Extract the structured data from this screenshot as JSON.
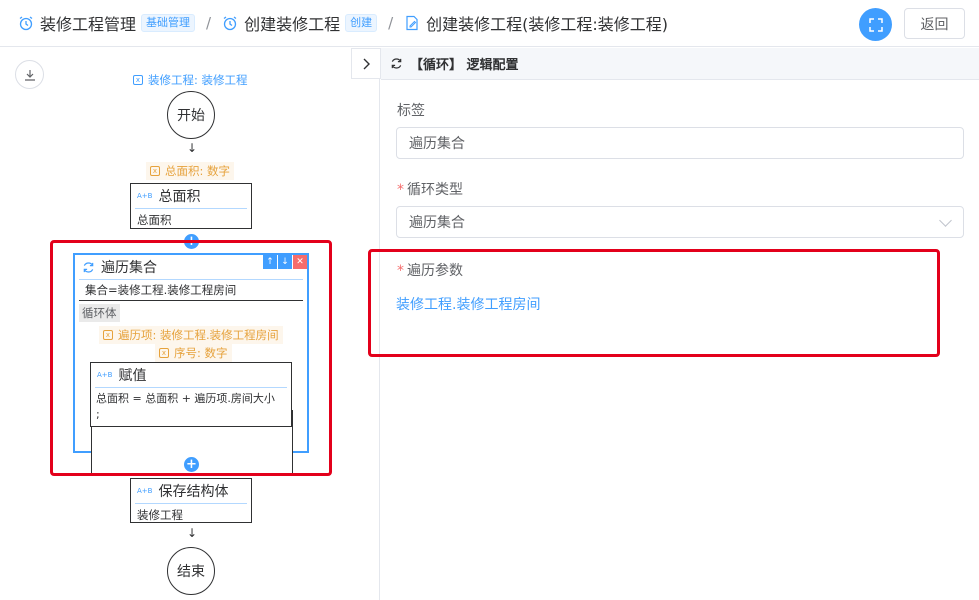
{
  "breadcrumb": [
    {
      "label": "装修工程管理",
      "tag": "基础管理",
      "icon": "alarm-clock-icon"
    },
    {
      "label": "创建装修工程",
      "tag": "创建",
      "icon": "alarm-clock-icon"
    },
    {
      "label": "创建装修工程(装修工程:装修工程)",
      "tag": "",
      "icon": "document-edit-icon"
    }
  ],
  "header": {
    "back_label": "返回"
  },
  "canvas": {
    "input_param": "装修工程: 装修工程",
    "start_label": "开始",
    "end_label": "结束",
    "area_param": "总面积: 数字",
    "node_area": {
      "badge": "A+B",
      "title": "总面积",
      "body": "总面积"
    },
    "loop": {
      "title": "遍历集合",
      "collection": "集合=装修工程.装修工程房间",
      "body_label": "循环体",
      "item_param": "遍历项: 装修工程.装修工程房间",
      "index_param": "序号: 数字"
    },
    "node_assign": {
      "badge": "A+B",
      "title": "赋值",
      "body_line1": "总面积 = 总面积 + 遍历项.房间大小",
      "body_line2": ";"
    },
    "node_save": {
      "badge": "A+B",
      "title": "保存结构体",
      "body": "装修工程"
    }
  },
  "panel": {
    "title": "【循环】 逻辑配置",
    "label_field": {
      "label": "标签",
      "value": "遍历集合"
    },
    "type_field": {
      "label": "循环类型",
      "value": "遍历集合"
    },
    "param_field": {
      "label": "遍历参数",
      "value": "装修工程.装修工程房间"
    }
  },
  "colors": {
    "accent": "#409eff",
    "highlight": "#e3001b",
    "param_orange": "#e6a23c"
  }
}
